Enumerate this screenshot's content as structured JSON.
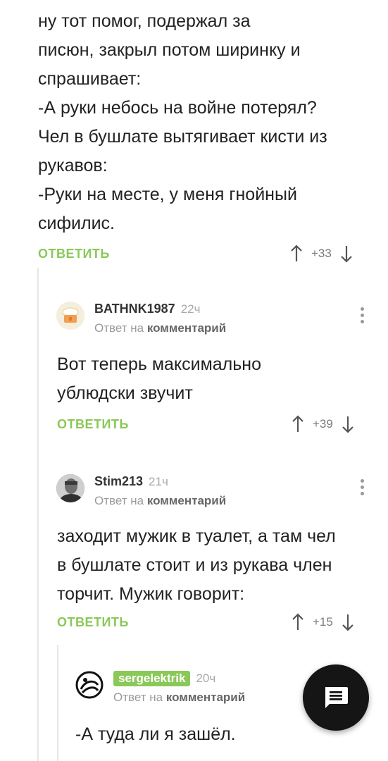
{
  "thread": [
    {
      "id": "root",
      "lines": [
        "ну тот помог, подержал за",
        "писюн, закрыл потом ширинку и",
        "спрашивает:",
        "-А руки небось на войне потерял?",
        "Чел в бушлате вытягивает кисти из",
        "рукавов:",
        "-Руки на месте, у меня гнойный",
        "сифилис."
      ],
      "reply_label": "ОТВЕТИТЬ",
      "score": "+33"
    },
    {
      "id": "c1",
      "username": "BATHNK1987",
      "time": "22ч",
      "reply_to_prefix": "Ответ на",
      "reply_to_link": "комментарий",
      "avatar_icon": "cake-avatar-icon",
      "lines": [
        "Вот теперь максимально",
        "ублюдски звучит"
      ],
      "reply_label": "ОТВЕТИТЬ",
      "score": "+39"
    },
    {
      "id": "c2",
      "username": "Stim213",
      "time": "21ч",
      "reply_to_prefix": "Ответ на",
      "reply_to_link": "комментарий",
      "avatar_icon": "photo-avatar-icon",
      "lines": [
        "заходит мужик в туалет, а там чел",
        "в бушлате стоит и из рукава член",
        "торчит. Мужик говорит:"
      ],
      "reply_label": "ОТВЕТИТЬ",
      "score": "+15"
    },
    {
      "id": "c3",
      "username": "sergelektrik",
      "time": "20ч",
      "reply_to_prefix": "Ответ на",
      "reply_to_link": "комментарий",
      "avatar_icon": "logo-avatar-icon",
      "lines": [
        "-А туда ли я зашёл."
      ]
    }
  ],
  "fab": {
    "icon": "message-icon"
  },
  "colors": {
    "accent": "#8ac858",
    "muted": "#9a9a9a",
    "text": "#222222",
    "fab": "#151515"
  }
}
